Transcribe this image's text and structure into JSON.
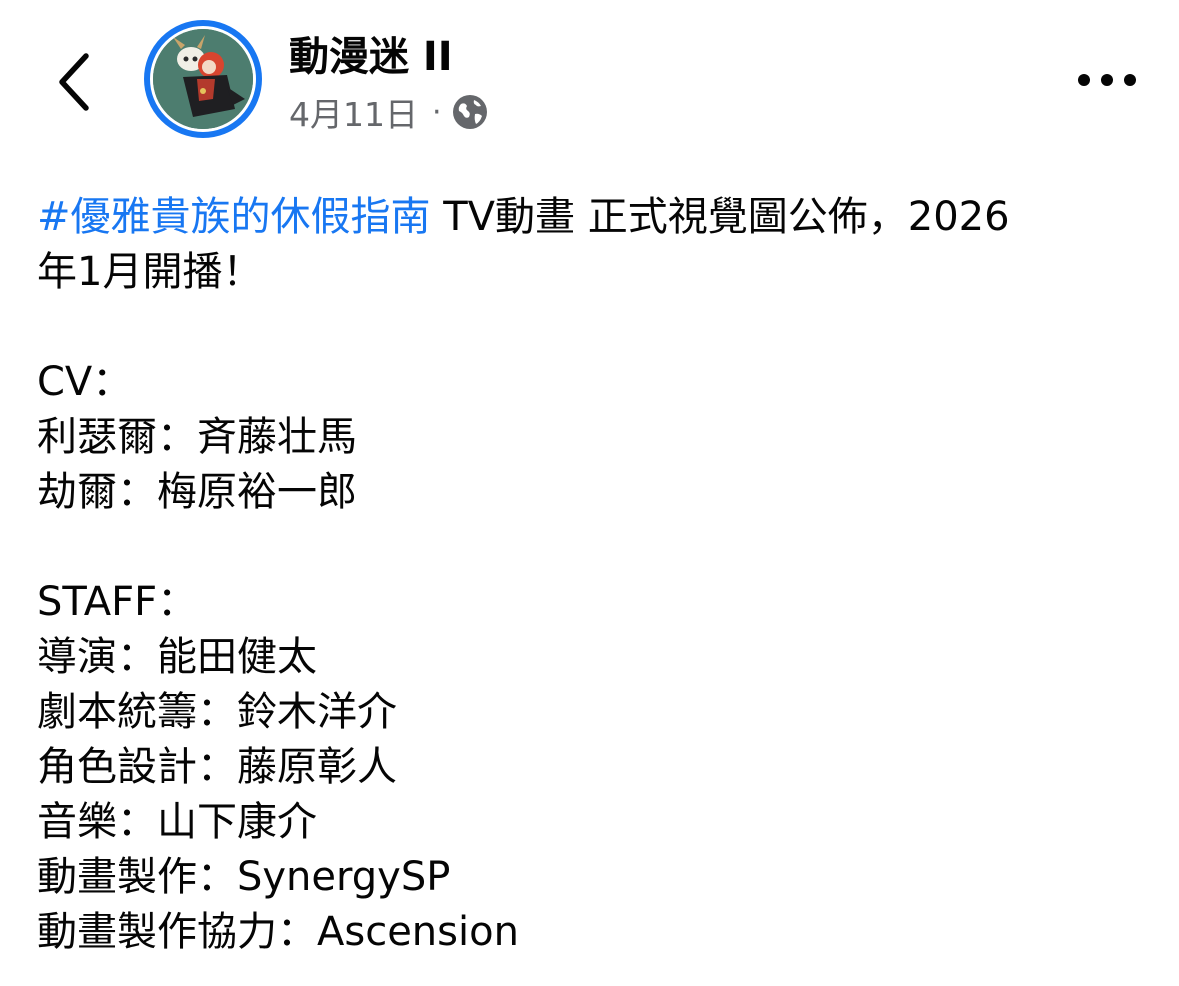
{
  "header": {
    "page_name": "動漫迷 II",
    "date": "4月11日",
    "separator": "·",
    "privacy_icon": "globe-icon",
    "back_icon": "chevron-left-icon",
    "more_icon": "more-horizontal-icon",
    "avatar_ring_color": "#1877f2"
  },
  "post": {
    "hashtag": "#優雅貴族的休假指南",
    "headline_rest": " TV動畫 正式視覺圖公佈，2026",
    "headline_line2": "年1月開播！",
    "cv_heading": "CV：",
    "cv_lines": [
      "利瑟爾：斉藤壮馬",
      "劫爾：梅原裕一郎"
    ],
    "staff_heading": "STAFF：",
    "staff_lines": [
      "導演：能田健太",
      "劇本統籌：鈴木洋介",
      "角色設計：藤原彰人",
      "音樂：山下康介",
      "動畫製作：SynergySP",
      "動畫製作協力：Ascension"
    ]
  },
  "colors": {
    "link": "#1877f2",
    "secondary_text": "#65676b",
    "primary_text": "#050505"
  }
}
